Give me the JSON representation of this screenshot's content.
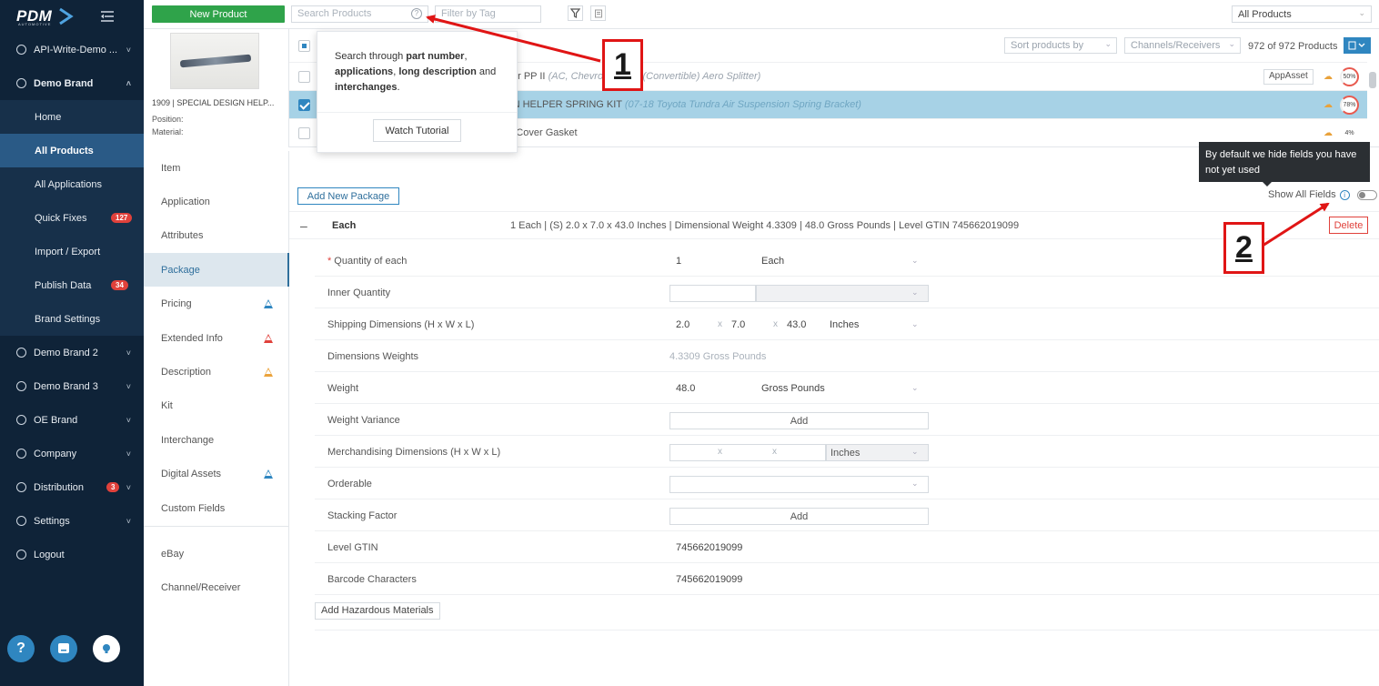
{
  "nav": {
    "logo": "PDM",
    "logo_sub": "AUTOMOTIVE",
    "items": [
      {
        "label": "API-Write-Demo ...",
        "type": "group"
      },
      {
        "label": "Demo Brand",
        "type": "group-open"
      },
      {
        "label": "Home",
        "type": "sub"
      },
      {
        "label": "All Products",
        "type": "sub-active"
      },
      {
        "label": "All Applications",
        "type": "sub"
      },
      {
        "label": "Quick Fixes",
        "type": "sub",
        "badge": "127"
      },
      {
        "label": "Import / Export",
        "type": "sub"
      },
      {
        "label": "Publish Data",
        "type": "sub",
        "badge": "34"
      },
      {
        "label": "Brand Settings",
        "type": "sub"
      },
      {
        "label": "Demo Brand 2",
        "type": "group"
      },
      {
        "label": "Demo Brand 3",
        "type": "group"
      },
      {
        "label": "OE Brand",
        "type": "group"
      },
      {
        "label": "Company",
        "type": "group"
      },
      {
        "label": "Distribution",
        "type": "group",
        "badge": "3"
      },
      {
        "label": "Settings",
        "type": "group"
      },
      {
        "label": "Logout",
        "type": "plain"
      }
    ],
    "help_label": "?"
  },
  "topbar": {
    "new_product": "New Product",
    "search_placeholder": "Search Products",
    "tag_placeholder": "Filter by Tag",
    "scope_select": "All Products"
  },
  "product_list": {
    "sort_placeholder": "Sort products by",
    "channels_placeholder": "Channels/Receivers",
    "count": "972 of 972 Products",
    "rows": [
      {
        "text": "oiler PP II",
        "italic": "(AC, Chevrolet, Ford (Convertible) Aero Splitter)",
        "asset": "AppAsset",
        "pct": "50%",
        "selected": false
      },
      {
        "text": "IGN HELPER SPRING KIT",
        "italic": "(07-18 Toyota Tundra Air Suspension Spring Bracket)",
        "asset": "",
        "pct": "78%",
        "selected": true
      },
      {
        "text": "ng Cover Gasket",
        "italic": "",
        "asset": "",
        "pct": "4%",
        "selected": false
      }
    ]
  },
  "preview": {
    "name": "1909 | SPECIAL DESIGN HELP...",
    "position_label": "Position:",
    "material_label": "Material:"
  },
  "tabs": [
    {
      "label": "Item",
      "warn": ""
    },
    {
      "label": "Application",
      "warn": ""
    },
    {
      "label": "Attributes",
      "warn": ""
    },
    {
      "label": "Package",
      "warn": "",
      "active": true
    },
    {
      "label": "Pricing",
      "warn": "blue"
    },
    {
      "label": "Extended Info",
      "warn": "red"
    },
    {
      "label": "Description",
      "warn": "orange"
    },
    {
      "label": "Kit",
      "warn": ""
    },
    {
      "label": "Interchange",
      "warn": ""
    },
    {
      "label": "Digital Assets",
      "warn": "blue"
    },
    {
      "label": "Custom Fields",
      "warn": ""
    },
    {
      "label": "eBay",
      "warn": ""
    },
    {
      "label": "Channel/Receiver",
      "warn": ""
    }
  ],
  "package": {
    "add_new": "Add New Package",
    "show_all_fields": "Show All Fields",
    "title": "Each",
    "summary": "1 Each | (S) 2.0 x 7.0 x 43.0 Inches | Dimensional Weight 4.3309 | 48.0 Gross Pounds | Level GTIN 745662019099",
    "delete": "Delete",
    "fields": {
      "quantity_label": "Quantity of each",
      "quantity_value": "1",
      "quantity_unit": "Each",
      "inner_label": "Inner Quantity",
      "shipping_label": "Shipping Dimensions (H x W x L)",
      "ship_h": "2.0",
      "ship_w": "7.0",
      "ship_l": "43.0",
      "ship_unit": "Inches",
      "dimw_label": "Dimensions Weights",
      "dimw_value": "4.3309 Gross Pounds",
      "weight_label": "Weight",
      "weight_value": "48.0",
      "weight_unit": "Gross Pounds",
      "variance_label": "Weight Variance",
      "add_label": "Add",
      "merch_label": "Merchandising Dimensions (H x W x L)",
      "merch_unit": "Inches",
      "orderable_label": "Orderable",
      "stacking_label": "Stacking Factor",
      "gtin_label": "Level GTIN",
      "gtin_value": "745662019099",
      "barcode_label": "Barcode Characters",
      "barcode_value": "745662019099",
      "x": "x"
    },
    "hazard_button": "Add Hazardous Materials"
  },
  "popover": {
    "text_1": "Search through ",
    "bold_1": "part number",
    "text_2": ", ",
    "bold_2": "applications",
    "text_3": ", ",
    "bold_3": "long description",
    "text_4": " and ",
    "bold_4": "interchanges",
    "text_5": ".",
    "watch": "Watch Tutorial"
  },
  "tooltip": "By default we hide fields you have not yet used",
  "callouts": {
    "one": "1",
    "two": "2"
  },
  "colors": {
    "nav_bg": "#0f2338",
    "accent": "#2f86c0",
    "new_button": "#2fa34a",
    "callout": "#e01515"
  }
}
